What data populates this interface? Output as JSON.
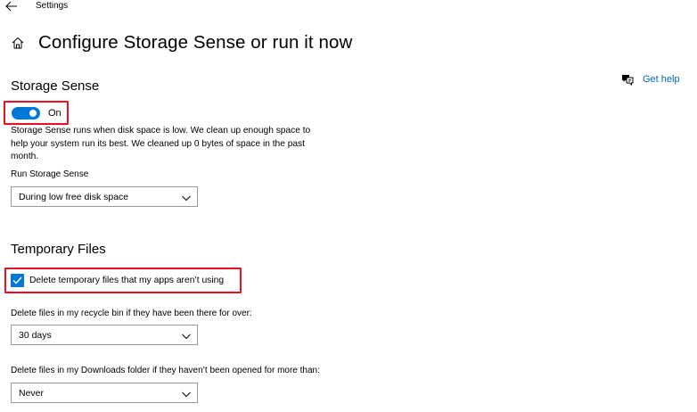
{
  "window": {
    "title": "Settings"
  },
  "page": {
    "title": "Configure Storage Sense or run it now"
  },
  "help": {
    "label": "Get help",
    "icon": "chat-help-icon"
  },
  "storage_sense": {
    "heading": "Storage Sense",
    "toggle_state": "On",
    "toggle_on": true,
    "description": "Storage Sense runs when disk space is low. We clean up enough space to help your system run its best. We cleaned up 0 bytes of space in the past month.",
    "run_label": "Run Storage Sense",
    "run_value": "During low free disk space"
  },
  "temporary_files": {
    "heading": "Temporary Files",
    "delete_temp_label": "Delete temporary files that my apps aren’t using",
    "delete_temp_checked": true,
    "recycle_label": "Delete files in my recycle bin if they have been there for over:",
    "recycle_value": "30 days",
    "downloads_label": "Delete files in my Downloads folder if they haven’t been opened for more than:",
    "downloads_value": "Never"
  },
  "colors": {
    "accent": "#0078d7",
    "link": "#0067b8",
    "highlight": "#e81123"
  }
}
